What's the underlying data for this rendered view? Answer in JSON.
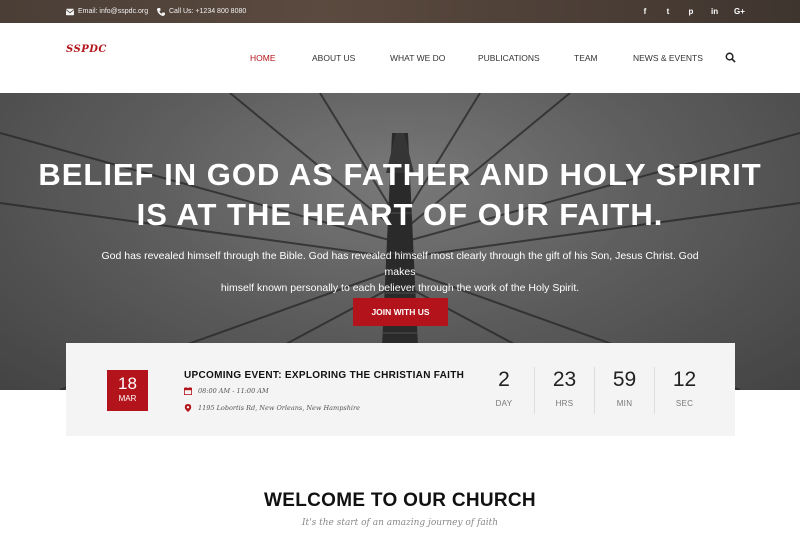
{
  "topbar": {
    "email": "Email: info@sspdc.org",
    "phone": "Call Us: +1234 800 8080",
    "social": [
      "f",
      "t",
      "p",
      "in",
      "G+"
    ]
  },
  "header": {
    "logo": "SSPDC",
    "nav": [
      "HOME",
      "ABOUT US",
      "WHAT WE DO",
      "PUBLICATIONS",
      "TEAM",
      "NEWS & EVENTS"
    ],
    "active_index": 0
  },
  "hero": {
    "headline_line1": "BELIEF IN GOD AS FATHER AND HOLY SPIRIT",
    "headline_line2": "IS AT THE HEART OF OUR FAITH.",
    "body_line1": "God has revealed himself through the Bible. God has revealed himself most clearly through the gift of his Son, Jesus Christ. God makes",
    "body_line2": "himself known personally to each believer through the work of the Holy Spirit.",
    "cta": "JOIN WITH US"
  },
  "event": {
    "day": "18",
    "month": "MAR",
    "title": "UPCOMING EVENT: EXPLORING THE CHRISTIAN FAITH",
    "time": "08:00 AM - 11:00 AM",
    "location": "1195 Lobortis Rd, New Orleans, New Hampshire",
    "countdown": [
      {
        "value": "2",
        "label": "DAY"
      },
      {
        "value": "23",
        "label": "HRS"
      },
      {
        "value": "59",
        "label": "MIN"
      },
      {
        "value": "12",
        "label": "SEC"
      }
    ]
  },
  "welcome": {
    "title": "WELCOME TO OUR CHURCH",
    "subtitle": "It's the start of an amazing journey of faith"
  },
  "colors": {
    "accent": "#b3141b",
    "topbar": "#4a3e36",
    "card": "#f4f4f4"
  }
}
